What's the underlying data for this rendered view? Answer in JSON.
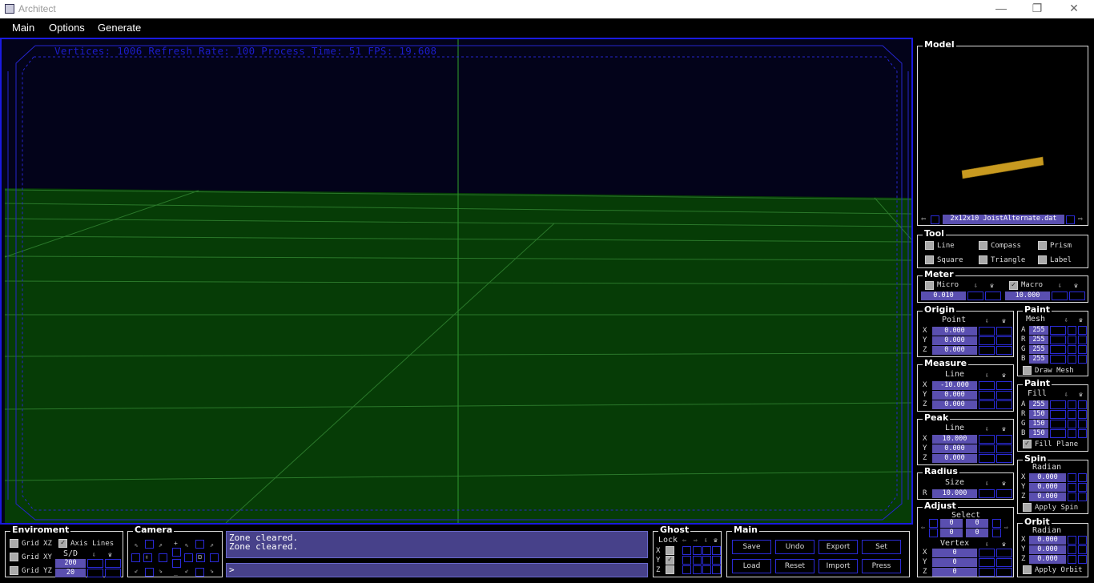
{
  "window": {
    "title": "Architect",
    "minimize": "—",
    "maximize": "❐",
    "close": "✕"
  },
  "menu": [
    "Main",
    "Options",
    "Generate"
  ],
  "viewport": {
    "stats": "Vertices: 1006 Refresh Rate: 100 Process Time: 51 FPS: 19.608"
  },
  "model": {
    "title": "Model",
    "file": "2x12x10 JoistAlternate.dat",
    "prev_icon": "⇦",
    "next_icon": "⇨",
    "beam_color": "#c89a20"
  },
  "tool": {
    "title": "Tool",
    "items": [
      "Line",
      "Compass",
      "Prism",
      "Square",
      "Triangle",
      "Label"
    ]
  },
  "meter": {
    "title": "Meter",
    "micro_label": "Micro",
    "macro_label": "Macro",
    "micro": "0.010",
    "macro": "10.000",
    "macro_checked": true
  },
  "origin": {
    "title": "Origin",
    "sub": "Point",
    "x": "0.000",
    "y": "0.000",
    "z": "0.000"
  },
  "measure": {
    "title": "Measure",
    "sub": "Line",
    "x": "-10.000",
    "y": "0.000",
    "z": "0.000"
  },
  "peak": {
    "title": "Peak",
    "sub": "Line",
    "x": "10.000",
    "y": "0.000",
    "z": "0.000"
  },
  "radius": {
    "title": "Radius",
    "sub": "Size",
    "r": "10.000"
  },
  "adjust": {
    "title": "Adjust",
    "sub": "Select",
    "sel": [
      "0",
      "0",
      "0",
      "0"
    ],
    "vertex_label": "Vertex",
    "x": "0",
    "y": "0",
    "z": "0"
  },
  "paint_mesh": {
    "title": "Paint",
    "sub": "Mesh",
    "a": "255",
    "r": "255",
    "g": "255",
    "b": "255",
    "toggle": "Draw Mesh"
  },
  "paint_fill": {
    "title": "Paint",
    "sub": "Fill",
    "a": "255",
    "r": "150",
    "g": "150",
    "b": "150",
    "toggle": "Fill Plane"
  },
  "spin": {
    "title": "Spin",
    "sub": "Radian",
    "x": "0.000",
    "y": "0.000",
    "z": "0.000",
    "toggle": "Apply Spin"
  },
  "orbit": {
    "title": "Orbit",
    "sub": "Radian",
    "x": "0.000",
    "y": "0.000",
    "z": "0.000",
    "toggle": "Apply Orbit"
  },
  "environment": {
    "title": "Enviroment",
    "grid_xz": "Grid XZ",
    "axis_lines": "Axis Lines",
    "grid_xy": "Grid XY",
    "grid_yz": "Grid YZ",
    "sd_label": "S/D",
    "s": "200",
    "d": "20"
  },
  "camera": {
    "title": "Camera"
  },
  "console": {
    "lines": "Zone cleared.\nZone cleared.",
    "prompt": ">"
  },
  "ghost": {
    "title": "Ghost",
    "lock": "Lock",
    "x": "X",
    "y": "Y",
    "z": "Z"
  },
  "main_panel": {
    "title": "Main",
    "buttons": [
      "Save",
      "Undo",
      "Export",
      "Set",
      "Load",
      "Reset",
      "Import",
      "Press"
    ]
  },
  "axis_labels": {
    "x": "X",
    "y": "Y",
    "z": "Z",
    "r": "R",
    "a": "A",
    "g": "G",
    "b": "B"
  }
}
